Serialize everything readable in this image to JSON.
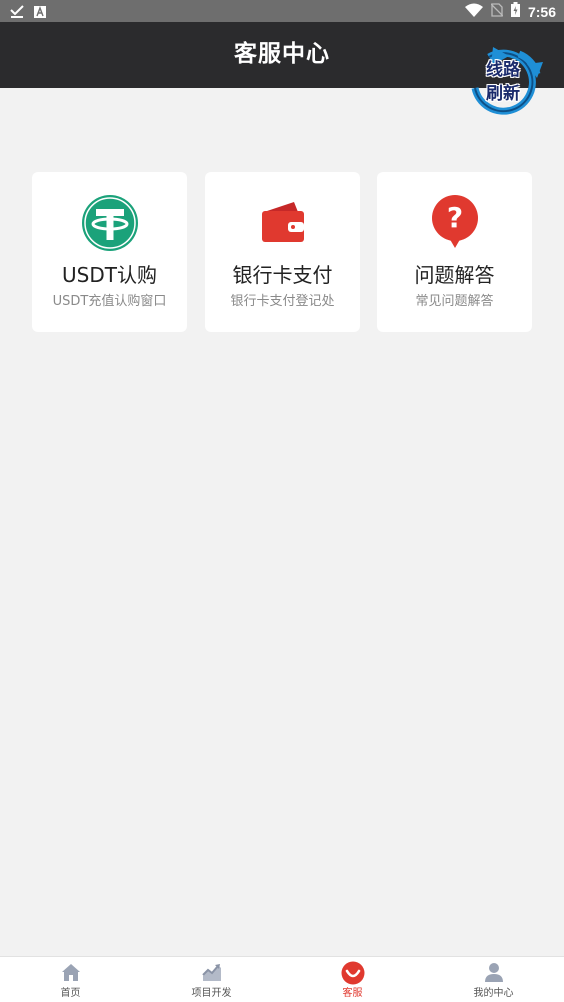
{
  "status_bar": {
    "time": "7:56",
    "icons": [
      "download-done-icon",
      "keyboard-a-icon",
      "wifi-icon",
      "no-sim-icon",
      "battery-charging-icon"
    ]
  },
  "header": {
    "title": "客服中心"
  },
  "refresh_badge": {
    "line1": "线路",
    "line2": "刷新"
  },
  "cards": [
    {
      "title": "USDT认购",
      "subtitle": "USDT充值认购窗口",
      "icon": "tether-icon",
      "color": "#1ba27a"
    },
    {
      "title": "银行卡支付",
      "subtitle": "银行卡支付登记处",
      "icon": "wallet-icon",
      "color": "#e0392f"
    },
    {
      "title": "问题解答",
      "subtitle": "常见问题解答",
      "icon": "question-icon",
      "color": "#e0392f"
    }
  ],
  "tabbar": {
    "active_color": "#e0392f",
    "items": [
      {
        "label": "首页",
        "icon": "home-icon"
      },
      {
        "label": "项目开发",
        "icon": "chart-trend-icon"
      },
      {
        "label": "客服",
        "icon": "customer-service-icon",
        "active": true
      },
      {
        "label": "我的中心",
        "icon": "user-icon"
      }
    ]
  }
}
